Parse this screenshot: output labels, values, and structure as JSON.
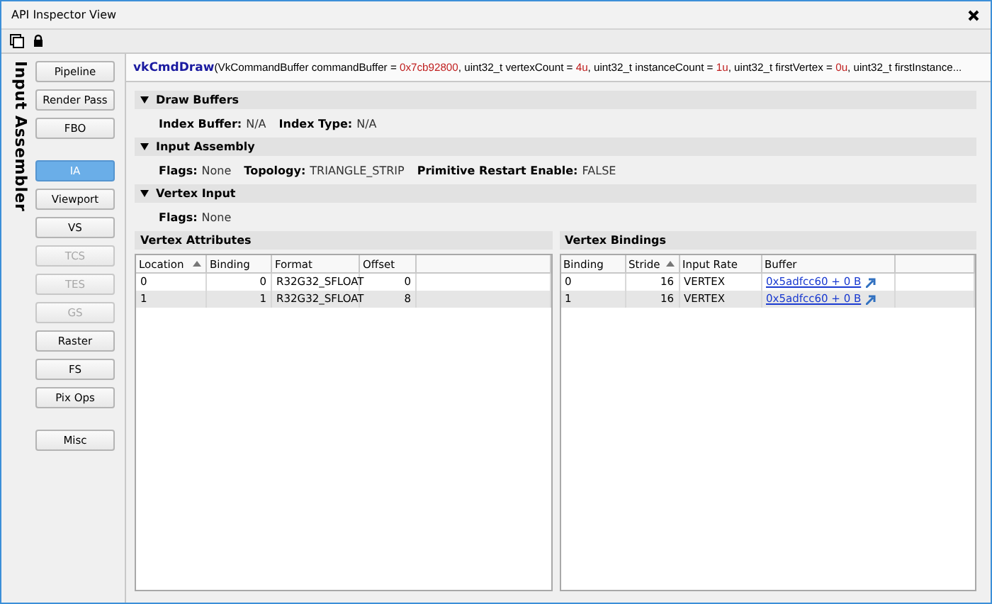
{
  "window": {
    "title": "API Inspector View"
  },
  "side_label": "Input Assembler",
  "stage_groups": [
    [
      {
        "label": "Pipeline",
        "selected": false,
        "disabled": false
      },
      {
        "label": "Render Pass",
        "selected": false,
        "disabled": false
      },
      {
        "label": "FBO",
        "selected": false,
        "disabled": false
      }
    ],
    [
      {
        "label": "IA",
        "selected": true,
        "disabled": false
      },
      {
        "label": "Viewport",
        "selected": false,
        "disabled": false
      },
      {
        "label": "VS",
        "selected": false,
        "disabled": false
      },
      {
        "label": "TCS",
        "selected": false,
        "disabled": true
      },
      {
        "label": "TES",
        "selected": false,
        "disabled": true
      },
      {
        "label": "GS",
        "selected": false,
        "disabled": true
      },
      {
        "label": "Raster",
        "selected": false,
        "disabled": false
      },
      {
        "label": "FS",
        "selected": false,
        "disabled": false
      },
      {
        "label": "Pix Ops",
        "selected": false,
        "disabled": false
      }
    ],
    [
      {
        "label": "Misc",
        "selected": false,
        "disabled": false
      }
    ]
  ],
  "signature": [
    {
      "kind": "name",
      "text": "vkCmdDraw"
    },
    {
      "kind": "text",
      "text": "(VkCommandBuffer commandBuffer = "
    },
    {
      "kind": "value",
      "text": "0x7cb92800"
    },
    {
      "kind": "text",
      "text": ", uint32_t vertexCount = "
    },
    {
      "kind": "value",
      "text": "4u"
    },
    {
      "kind": "text",
      "text": ", uint32_t instanceCount = "
    },
    {
      "kind": "value",
      "text": "1u"
    },
    {
      "kind": "text",
      "text": ", uint32_t firstVertex = "
    },
    {
      "kind": "value",
      "text": "0u"
    },
    {
      "kind": "text",
      "text": ", uint32_t firstInstance..."
    }
  ],
  "sections": [
    {
      "title": "Draw Buffers",
      "expanded": true,
      "fields": [
        {
          "label": "Index Buffer:",
          "value": "N/A"
        },
        {
          "label": "Index Type:",
          "value": "N/A"
        }
      ]
    },
    {
      "title": "Input Assembly",
      "expanded": true,
      "fields": [
        {
          "label": "Flags:",
          "value": "None"
        },
        {
          "label": "Topology:",
          "value": "TRIANGLE_STRIP"
        },
        {
          "label": "Primitive Restart Enable:",
          "value": "FALSE"
        }
      ]
    },
    {
      "title": "Vertex Input",
      "expanded": true,
      "fields": [
        {
          "label": "Flags:",
          "value": "None"
        }
      ]
    }
  ],
  "tables": [
    {
      "title": "Vertex Attributes",
      "columns": [
        {
          "label": "Location",
          "sorted": true
        },
        {
          "label": "Binding",
          "sorted": false
        },
        {
          "label": "Format",
          "sorted": false
        },
        {
          "label": "Offset",
          "sorted": false
        }
      ],
      "rows": [
        {
          "cells": [
            {
              "kind": "text",
              "text": "0"
            },
            {
              "kind": "text",
              "text": "0"
            },
            {
              "kind": "text",
              "text": "R32G32_SFLOAT"
            },
            {
              "kind": "text",
              "text": "0"
            }
          ]
        },
        {
          "cells": [
            {
              "kind": "text",
              "text": "1"
            },
            {
              "kind": "text",
              "text": "1"
            },
            {
              "kind": "text",
              "text": "R32G32_SFLOAT"
            },
            {
              "kind": "text",
              "text": "8"
            }
          ]
        }
      ]
    },
    {
      "title": "Vertex Bindings",
      "columns": [
        {
          "label": "Binding",
          "sorted": false
        },
        {
          "label": "Stride",
          "sorted": true
        },
        {
          "label": "Input Rate",
          "sorted": false
        },
        {
          "label": "Buffer",
          "sorted": false
        }
      ],
      "rows": [
        {
          "cells": [
            {
              "kind": "text",
              "text": "0"
            },
            {
              "kind": "text",
              "text": "16"
            },
            {
              "kind": "text",
              "text": "VERTEX"
            },
            {
              "kind": "link",
              "text": "0x5adfcc60 + 0 B"
            }
          ]
        },
        {
          "cells": [
            {
              "kind": "text",
              "text": "1"
            },
            {
              "kind": "text",
              "text": "16"
            },
            {
              "kind": "text",
              "text": "VERTEX"
            },
            {
              "kind": "link",
              "text": "0x5adfcc60 + 0 B"
            }
          ]
        }
      ]
    }
  ]
}
